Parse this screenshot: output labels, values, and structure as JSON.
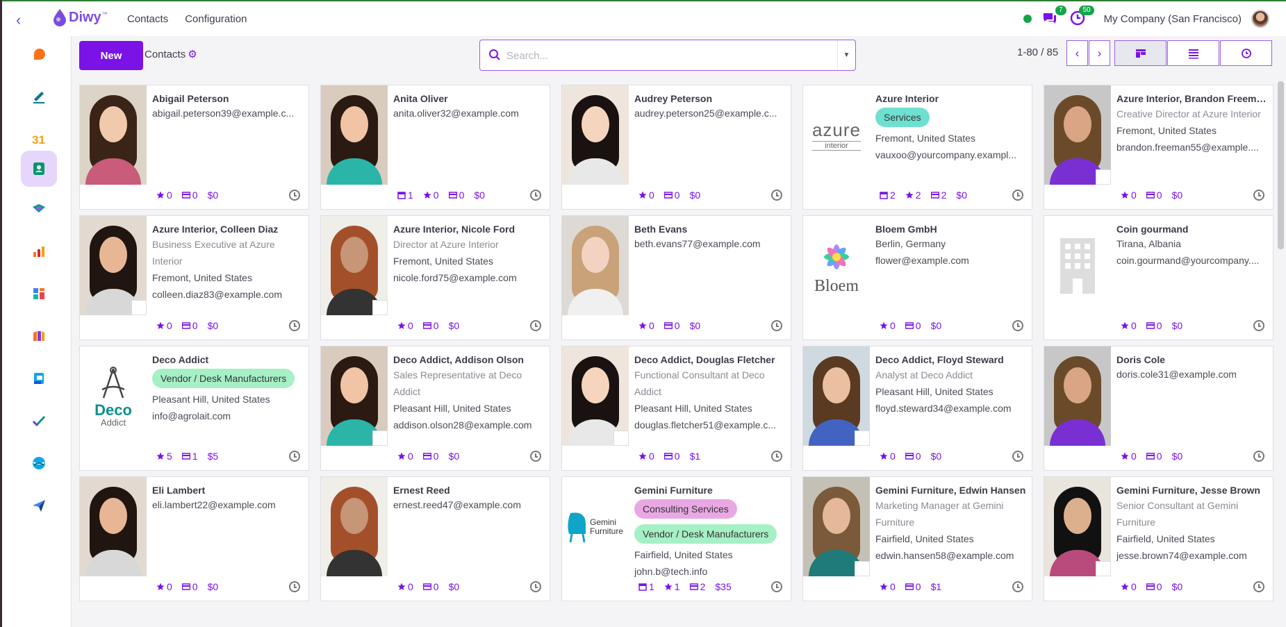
{
  "nav": {
    "back_glyph": "‹",
    "brand": "Diwy",
    "brand_tm": "™",
    "menu": [
      "Contacts",
      "Configuration"
    ],
    "messages_count": "7",
    "activities_count": "50",
    "company": "My Company (San Francisco)"
  },
  "toolbar": {
    "new_label": "New",
    "breadcrumb": "Contacts",
    "search_placeholder": "Search...",
    "pager": "1-80 / 85",
    "prev_glyph": "‹",
    "next_glyph": "›"
  },
  "sidebar_apps": [
    "discuss-icon",
    "notes-icon",
    "calendar-icon",
    "contacts-icon",
    "crm-icon",
    "sales-icon",
    "dashboards-icon",
    "pos-icon",
    "invoicing-icon",
    "project-icon",
    "website-icon",
    "marketing-icon"
  ],
  "logo_texts": {
    "azure_main": "azure",
    "azure_sub": "interior",
    "bloem": "Bloem",
    "deco_main": "Deco",
    "deco_sub": "Addict",
    "gemini": "Gemini Furniture"
  },
  "cards": [
    {
      "name": "Abigail Peterson",
      "email": "abigail.peterson39@example.c...",
      "stats": {
        "stars": "0",
        "cards": "0",
        "money": "$0"
      }
    },
    {
      "name": "Anita Oliver",
      "email": "anita.oliver32@example.com",
      "stats": {
        "cal": "1",
        "stars": "0",
        "cards": "0",
        "money": "$0"
      }
    },
    {
      "name": "Audrey Peterson",
      "email": "audrey.peterson25@example.c...",
      "stats": {
        "stars": "0",
        "cards": "0",
        "money": "$0"
      }
    },
    {
      "name": "Azure Interior",
      "tag": "Services",
      "location": "Fremont, United States",
      "email": "vauxoo@yourcompany.exampl...",
      "stats": {
        "cal": "2",
        "stars": "2",
        "cards": "2",
        "money": "$0"
      }
    },
    {
      "name": "Azure Interior, Brandon Freeman",
      "function": "Creative Director at Azure Interior",
      "location": "Fremont, United States",
      "email": "brandon.freeman55@example....",
      "stats": {
        "stars": "0",
        "cards": "0",
        "money": "$0"
      }
    },
    {
      "name": "Azure Interior, Colleen Diaz",
      "function": "Business Executive at Azure Interior",
      "location": "Fremont, United States",
      "email": "colleen.diaz83@example.com",
      "stats": {
        "stars": "0",
        "cards": "0",
        "money": "$0"
      }
    },
    {
      "name": "Azure Interior, Nicole Ford",
      "function": "Director at Azure Interior",
      "location": "Fremont, United States",
      "email": "nicole.ford75@example.com",
      "stats": {
        "stars": "0",
        "cards": "0",
        "money": "$0"
      }
    },
    {
      "name": "Beth Evans",
      "email": "beth.evans77@example.com",
      "stats": {
        "stars": "0",
        "cards": "0",
        "money": "$0"
      }
    },
    {
      "name": "Bloem GmbH",
      "location": "Berlin, Germany",
      "email": "flower@example.com",
      "stats": {
        "stars": "0",
        "cards": "0",
        "money": "$0"
      }
    },
    {
      "name": "Coin gourmand",
      "location": "Tirana, Albania",
      "email": "coin.gourmand@yourcompany....",
      "stats": {
        "stars": "0",
        "cards": "0",
        "money": "$0"
      }
    },
    {
      "name": "Deco Addict",
      "tag": "Vendor / Desk Manufacturers",
      "location": "Pleasant Hill, United States",
      "email": "info@agrolait.com",
      "stats": {
        "stars": "5",
        "cards": "1",
        "money": "$5"
      }
    },
    {
      "name": "Deco Addict, Addison Olson",
      "function": "Sales Representative at Deco Addict",
      "location": "Pleasant Hill, United States",
      "email": "addison.olson28@example.com",
      "stats": {
        "stars": "0",
        "cards": "0",
        "money": "$0"
      }
    },
    {
      "name": "Deco Addict, Douglas Fletcher",
      "function": "Functional Consultant at Deco Addict",
      "location": "Pleasant Hill, United States",
      "email": "douglas.fletcher51@example.c...",
      "stats": {
        "stars": "0",
        "cards": "0",
        "money": "$1"
      }
    },
    {
      "name": "Deco Addict, Floyd Steward",
      "function": "Analyst at Deco Addict",
      "location": "Pleasant Hill, United States",
      "email": "floyd.steward34@example.com",
      "stats": {
        "stars": "0",
        "cards": "0",
        "money": "$0"
      }
    },
    {
      "name": "Doris Cole",
      "email": "doris.cole31@example.com",
      "stats": {
        "stars": "0",
        "cards": "0",
        "money": "$0"
      }
    },
    {
      "name": "Eli Lambert",
      "email": "eli.lambert22@example.com",
      "stats": {
        "stars": "0",
        "cards": "0",
        "money": "$0"
      }
    },
    {
      "name": "Ernest Reed",
      "email": "ernest.reed47@example.com",
      "stats": {
        "stars": "0",
        "cards": "0",
        "money": "$0"
      }
    },
    {
      "name": "Gemini Furniture",
      "tag": "Consulting Services",
      "tag2": "Vendor / Desk Manufacturers",
      "location": "Fairfield, United States",
      "email": "john.b@tech.info",
      "stats": {
        "cal": "1",
        "stars": "1",
        "cards": "2",
        "money": "$35"
      }
    },
    {
      "name": "Gemini Furniture, Edwin Hansen",
      "function": "Marketing Manager at Gemini Furniture",
      "location": "Fairfield, United States",
      "email": "edwin.hansen58@example.com",
      "stats": {
        "stars": "0",
        "cards": "0",
        "money": "$1"
      }
    },
    {
      "name": "Gemini Furniture, Jesse Brown",
      "function": "Senior Consultant at Gemini Furniture",
      "location": "Fairfield, United States",
      "email": "jesse.brown74@example.com",
      "stats": {
        "stars": "0",
        "cards": "0",
        "money": "$0"
      }
    }
  ],
  "colors": {
    "accent": "#7b12e6",
    "status": "#16a34a"
  }
}
